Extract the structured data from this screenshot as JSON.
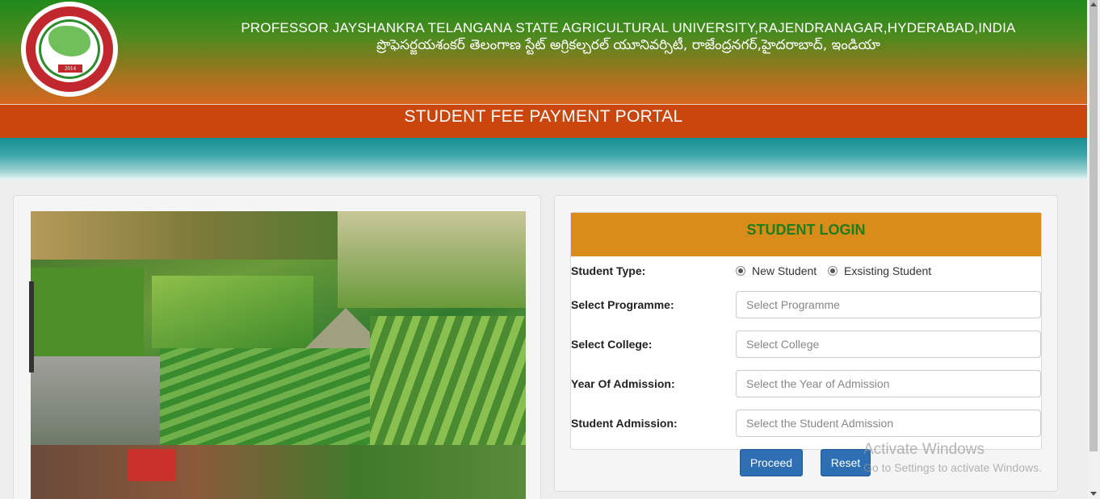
{
  "header": {
    "university_name_en": "PROFESSOR JAYSHANKRA TELANGANA STATE AGRICULTURAL UNIVERSITY,RAJENDRANAGAR,HYDERABAD,INDIA",
    "university_name_te": "ప్రొఫెసర్జయశంకర్ తెలంగాణ స్టేట్ అగ్రికల్చరల్ యూనివర్సిటీ, రాజేంద్రనగర్,హైదరాబాద్, ఇండియా",
    "logo_year": "2014",
    "portal_title": "STUDENT FEE PAYMENT PORTAL"
  },
  "login": {
    "title": "STUDENT LOGIN",
    "student_type_label": "Student Type:",
    "radio_new": "New Student",
    "radio_existing": "Exsisting Student",
    "programme_label": "Select Programme:",
    "programme_placeholder": "Select Programme",
    "college_label": "Select College:",
    "college_placeholder": "Select College",
    "year_label": "Year Of Admission:",
    "year_placeholder": "Select the Year of Admission",
    "admission_label": "Student Admission:",
    "admission_placeholder": "Select the Student Admission",
    "proceed_label": "Proceed",
    "reset_label": "Reset"
  },
  "watermark": {
    "line1": "Activate Windows",
    "line2": "Go to Settings to activate Windows."
  },
  "colors": {
    "header_green": "#1f8a1b",
    "portal_bar": "#c9460d",
    "login_header": "#d98c1a",
    "login_title": "#1e7d1e",
    "button": "#2e6fb3"
  }
}
